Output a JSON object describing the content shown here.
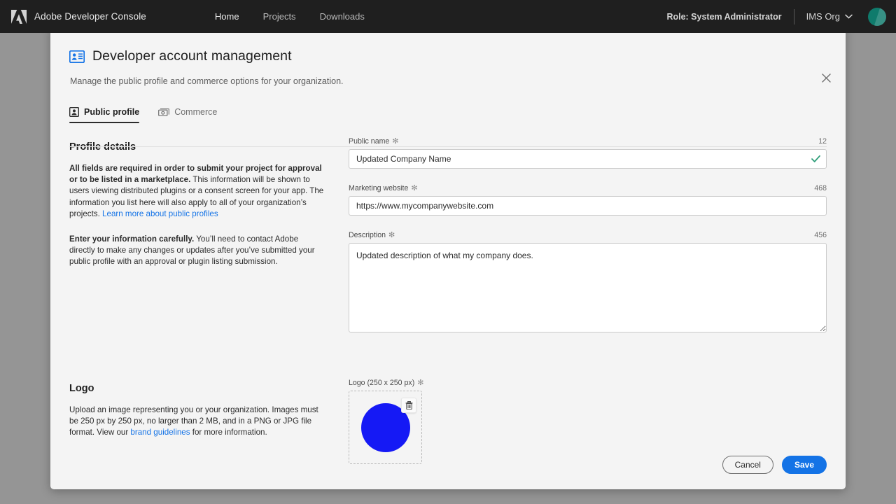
{
  "topbar": {
    "logo_icon": "adobe-logo-icon",
    "brand": "Adobe Developer Console",
    "nav": [
      {
        "label": "Home",
        "active": true
      },
      {
        "label": "Projects",
        "active": false
      },
      {
        "label": "Downloads",
        "active": false
      }
    ],
    "role": "Role: System Administrator",
    "ims_org": "IMS Org",
    "ims_org_icon": "chevron-down-icon",
    "avatar_icon": "avatar",
    "bar_color": "#1f1f1f",
    "avatar_color": "#0f7b6c"
  },
  "modal": {
    "title": "Developer account management",
    "title_icon": "id-card-icon",
    "subtitle": "Manage the public profile and commerce options for your organization.",
    "close_icon": "close-icon",
    "tabs": [
      {
        "label": "Public profile",
        "icon": "person-card-icon",
        "active": true
      },
      {
        "label": "Commerce",
        "icon": "banknote-icon",
        "active": false
      }
    ]
  },
  "profile_details": {
    "heading": "Profile details",
    "para1_bold": "All fields are required in order to submit your project for approval or to be listed in a marketplace.",
    "para1_rest": " This information will be shown to users viewing distributed plugins or a consent screen for your app. The information you list here will also apply to all of your organization’s projects. ",
    "para1_link": "Learn more about public profiles",
    "para2_bold": "Enter your information carefully.",
    "para2_rest": " You’ll need to contact Adobe directly to make any changes or updates after you’ve submitted your public profile with an approval or plugin listing submission."
  },
  "fields": {
    "public_name": {
      "label": "Public name",
      "required_mark": "✻",
      "counter": "12",
      "value": "Updated Company Name",
      "placeholder": "Public name",
      "valid_icon": "checkmark-icon",
      "valid_color": "#2d9d78"
    },
    "marketing_website": {
      "label": "Marketing website",
      "required_mark": "✻",
      "counter": "468",
      "value": "https://www.mycompanywebsite.com",
      "placeholder": "https://"
    },
    "description": {
      "label": "Description",
      "required_mark": "✻",
      "counter": "456",
      "value": "Updated description of what my company does.",
      "placeholder": "Description"
    }
  },
  "logo_section": {
    "heading": "Logo",
    "para_part1": "Upload an image representing you or your organization. Images must be 250 px by 250 px, no larger than 2 MB, and in a PNG or JPG file format. View our ",
    "para_link": "brand guidelines",
    "para_part2": " for more information.",
    "field_label": "Logo (250 x 250 px)",
    "required_mark": "✻",
    "delete_icon": "trash-icon",
    "logo_color": "#1519f5"
  },
  "footer": {
    "cancel_label": "Cancel",
    "save_label": "Save",
    "save_color": "#1473e6"
  }
}
